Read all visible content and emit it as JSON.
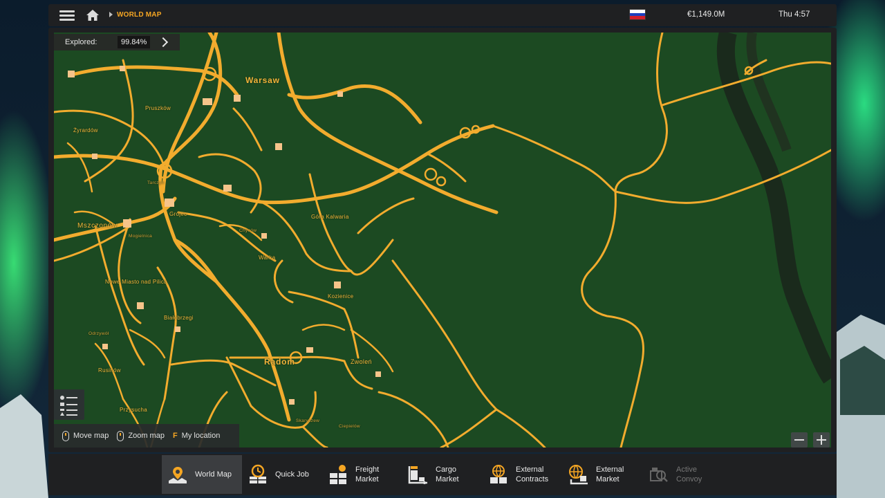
{
  "topbar": {
    "breadcrumb": "WORLD MAP",
    "money": "€1,149.0M",
    "clock": "Thu 4:57",
    "flag": "russia-flag",
    "flag_colors": [
      "#ffffff",
      "#1c3fbf",
      "#d21f2b"
    ]
  },
  "map": {
    "explored_label": "Explored:",
    "explored_value": "99.84%",
    "road_color": "#f2ac2e",
    "land_color": "#1c4a22",
    "cities": {
      "warsaw": "Warsaw",
      "pruszkow": "Pruszków",
      "zyrardow": "Żyrardów",
      "tarczyn": "Tarczyn",
      "gora_kalwaria": "Góra Kalwaria",
      "chynow": "Chynów",
      "mszczonow": "Mszczonów",
      "grojec": "Grójec",
      "mogielnica": "Mogielnica",
      "warka": "Warka",
      "nowe_miasto": "Nowe Miasto nad Pilicą",
      "kozienice": "Kozienice",
      "bialobrzegi": "Białobrzegi",
      "odrzywol": "Odrzywół",
      "radom": "Radom",
      "zwolen": "Zwoleń",
      "rusinow": "Rusinów",
      "przysucha": "Przysucha",
      "skaryszew": "Skaryszew",
      "ciepielow": "Ciepielów"
    },
    "hints": {
      "move": "Move map",
      "zoom": "Zoom map",
      "location_key": "F",
      "location": "My location"
    }
  },
  "nav": {
    "items": [
      {
        "label": "World Map",
        "icon": "world-map-icon",
        "active": true
      },
      {
        "label": "Quick Job",
        "icon": "clock-icon"
      },
      {
        "label": "Freight Market",
        "icon": "freight-icon"
      },
      {
        "label": "Cargo Market",
        "icon": "cargo-icon"
      },
      {
        "label": "External Contracts",
        "icon": "globe-contracts-icon"
      },
      {
        "label": "External Market",
        "icon": "globe-market-icon"
      },
      {
        "label": "Active Convoy",
        "icon": "convoy-icon",
        "disabled": true
      }
    ]
  }
}
